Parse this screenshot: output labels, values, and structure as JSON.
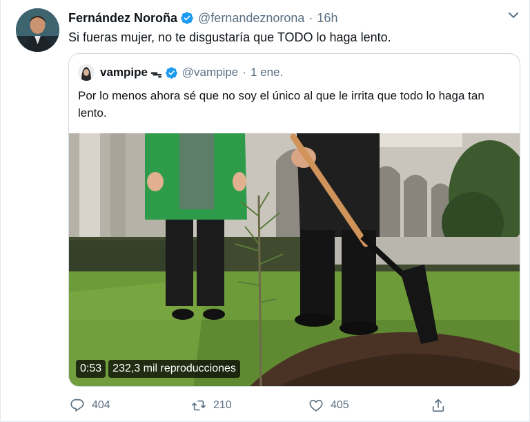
{
  "tweet": {
    "author_name": "Fernández Noroña",
    "author_handle": "@fernandeznorona",
    "separator": "·",
    "time": "16h",
    "text": "Si fueras mujer, no te disgustaría que TODO lo haga lento.",
    "avatar_icon": "user-avatar",
    "verified_icon": "verified-badge-icon",
    "menu_icon": "chevron-down-icon"
  },
  "quoted": {
    "author_name": "vampipe",
    "emoji": "ᯓ",
    "author_handle": "@vampipe",
    "separator": "·",
    "date": "1 ene.",
    "text": "Por lo menos ahora sé que no soy el único al que le irrita que todo lo haga tan lento.",
    "video": {
      "duration": "0:53",
      "views": "232,3 mil reproducciones"
    }
  },
  "actions": {
    "reply_count": "404",
    "retweet_count": "210",
    "like_count": "405"
  },
  "colors": {
    "text_primary": "#0f1419",
    "text_secondary": "#5b7083",
    "verified_blue": "#1d9bf0",
    "border": "#cfd9de"
  }
}
